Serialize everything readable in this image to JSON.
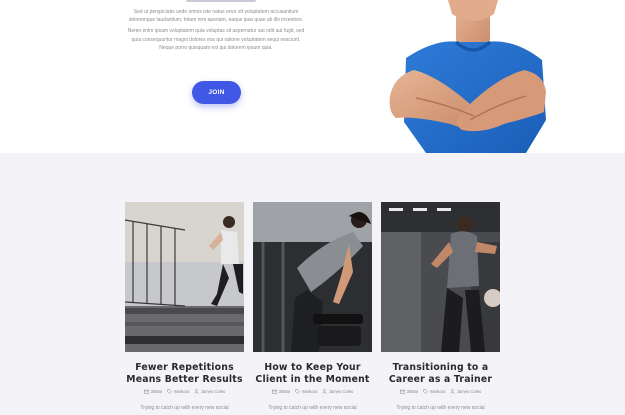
{
  "hero": {
    "paragraph_1": "Sed ut perspiciatis unde omnis iste natus error sit voluptatem accusantium doloremque laudantium, totam rem aperiam, eaque ipsa quae ab illo inventore.",
    "paragraph_2": "Nemo enim ipsam voluptatem quia voluptas sit aspernatur aut odit aut fugit, sed quia consequuntur magni dolores eos qui ratione voluptatem sequi nesciunt. Neque porro quisquam est qui dolorem ipsum quia.",
    "join_label": "JOIN",
    "accent_color": "#4157e6"
  },
  "blog": {
    "posts": [
      {
        "title": "Fewer Repetitions Means Better Results",
        "date": "30Mar",
        "category": "Workout",
        "author": "James Coles",
        "excerpt": "Trying to catch up with every new social"
      },
      {
        "title": "How to Keep Your Client in the Moment",
        "date": "30Mar",
        "category": "Workout",
        "author": "James Coles",
        "excerpt": "Trying to catch up with every new social"
      },
      {
        "title": "Transitioning to a Career as a Trainer",
        "date": "30Mar",
        "category": "Workout",
        "author": "James Coles",
        "excerpt": "Trying to catch up with every new social"
      }
    ],
    "meta_icons": [
      "calendar-icon",
      "tag-icon",
      "user-icon"
    ]
  }
}
